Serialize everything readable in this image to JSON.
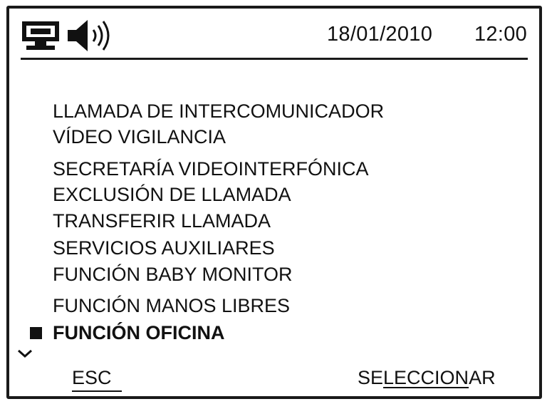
{
  "status": {
    "icons": [
      "intercom-network-icon",
      "speaker-volume-icon"
    ],
    "date": "18/01/2010",
    "time": "12:00"
  },
  "menu": {
    "items": [
      {
        "label": "LLAMADA DE INTERCOMUNICADOR"
      },
      {
        "label": "VÍDEO VIGILANCIA"
      },
      {
        "label": "SECRETARÍA VIDEOINTERFÓNICA"
      },
      {
        "label": "EXCLUSIÓN DE LLAMADA"
      },
      {
        "label": "TRANSFERIR LLAMADA"
      },
      {
        "label": "SERVICIOS AUXILIARES"
      },
      {
        "label": "FUNCIÓN BABY MONITOR"
      },
      {
        "label": "FUNCIÓN MANOS LIBRES"
      },
      {
        "label": "FUNCIÓN OFICINA",
        "selected": true
      }
    ],
    "scroll_indicator": "chevron-down-icon"
  },
  "softkeys": {
    "esc_label": "ESC",
    "select_pre": "SE",
    "select_mid": "LECCION",
    "select_post": "AR"
  }
}
